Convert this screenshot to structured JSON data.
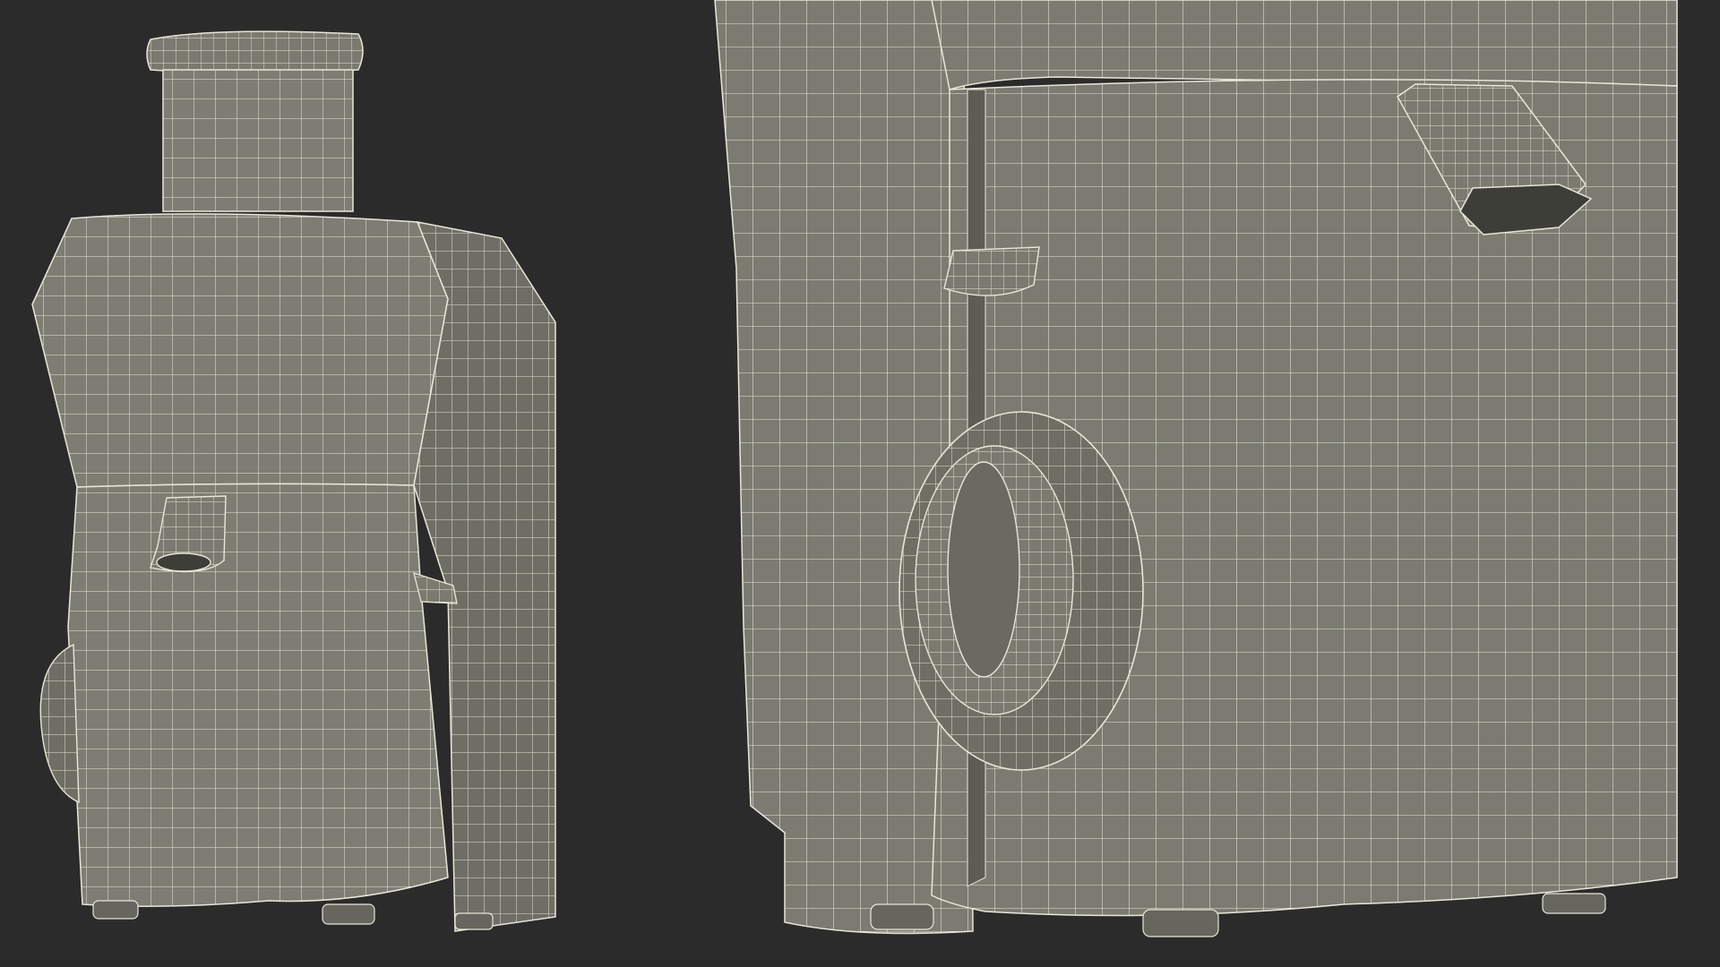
{
  "scene": {
    "background": "#2b2b2b",
    "mesh_fill": "#7d7d73",
    "mesh_fill_dark": "#6e6e65",
    "wire_color": "#e9e6d8",
    "views": [
      {
        "label": "full-view",
        "subject": "juicer-wireframe"
      },
      {
        "label": "closeup-view",
        "subject": "juicer-wireframe-closeup"
      }
    ]
  }
}
